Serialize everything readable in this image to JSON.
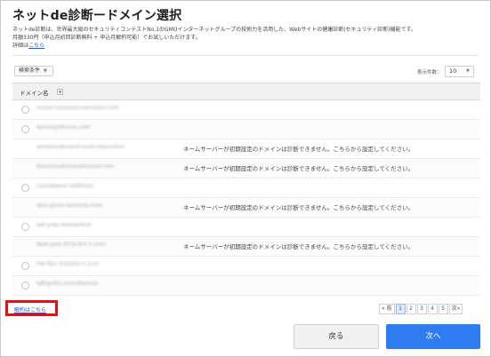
{
  "page": {
    "title": "ネットde診断ードメイン選択",
    "description_line1": "ネットde診断は、世界最大級のセキュリティコンテストNo.1のGMOインターネットグループの技術力を活用した、Webサイトの健康診断(セキュリティ診断)機能です。",
    "description_line2": "月額330円（申込月初回診断無料 + 申込月解約可能）でお試しいただけます。",
    "details_prefix": "詳細は",
    "details_link": "こちら"
  },
  "toolbar": {
    "filter_label": "検索条件",
    "filter_caret": "▼",
    "perpage_label": "表示件数：",
    "perpage_value": "10",
    "perpage_caret": "▼"
  },
  "table": {
    "column_header": "ドメイン名",
    "sort_icon": "▼",
    "rows": [
      {
        "domain": "nunuri-nnununs-nanuinuri.com",
        "selectable": true,
        "notice": ""
      },
      {
        "domain": "wsunaymhunui.com",
        "selectable": true,
        "notice": ""
      },
      {
        "domain": "ssnanuiuenunuirunuirunsunuirun",
        "selectable": false,
        "notice": "ネームサーバーが初期設定のドメインは診断できません。こちらから設定してください。"
      },
      {
        "domain": "bssunuiuenunsuenunsur.com",
        "selectable": false,
        "notice": "ネームサーバーが初期設定のドメインは診断できません。こちらから設定してください。"
      },
      {
        "domain": "Lsnuasseun-ssSSrsun",
        "selectable": true,
        "notice": ""
      },
      {
        "domain": "sers-ysrun-ssrunrss.nrun",
        "selectable": false,
        "notice": "ネームサーバーが初期設定のドメインは診断できません。こちらから設定してください。"
      },
      {
        "domain": "swr-yrss-rsrsrssrsrun",
        "selectable": true,
        "notice": ""
      },
      {
        "domain": "fwet-ysrs-37r3r3r3-7.rrrrrr",
        "selectable": false,
        "notice": "ネームサーバーが初期設定のドメインは診断できません。こちらから設定してください。"
      },
      {
        "domain": "Fwr-fsrr-7r2r2r2r-1-3.rrr",
        "selectable": true,
        "notice": ""
      },
      {
        "domain": "sdfrgrrfrs-srssrsfrsrsrsn",
        "selectable": true,
        "notice": ""
      }
    ]
  },
  "footer": {
    "contract_link": "解約はこちら",
    "pager": {
      "prev": "« 前",
      "pages": [
        "1",
        "2",
        "3",
        "4",
        "5"
      ],
      "active_page": "1",
      "next": "次»"
    },
    "back_label": "戻る",
    "next_label": "次へ"
  },
  "colors": {
    "accent": "#2f7bf0",
    "link": "#1a5fd6",
    "highlight": "#e0101a"
  }
}
